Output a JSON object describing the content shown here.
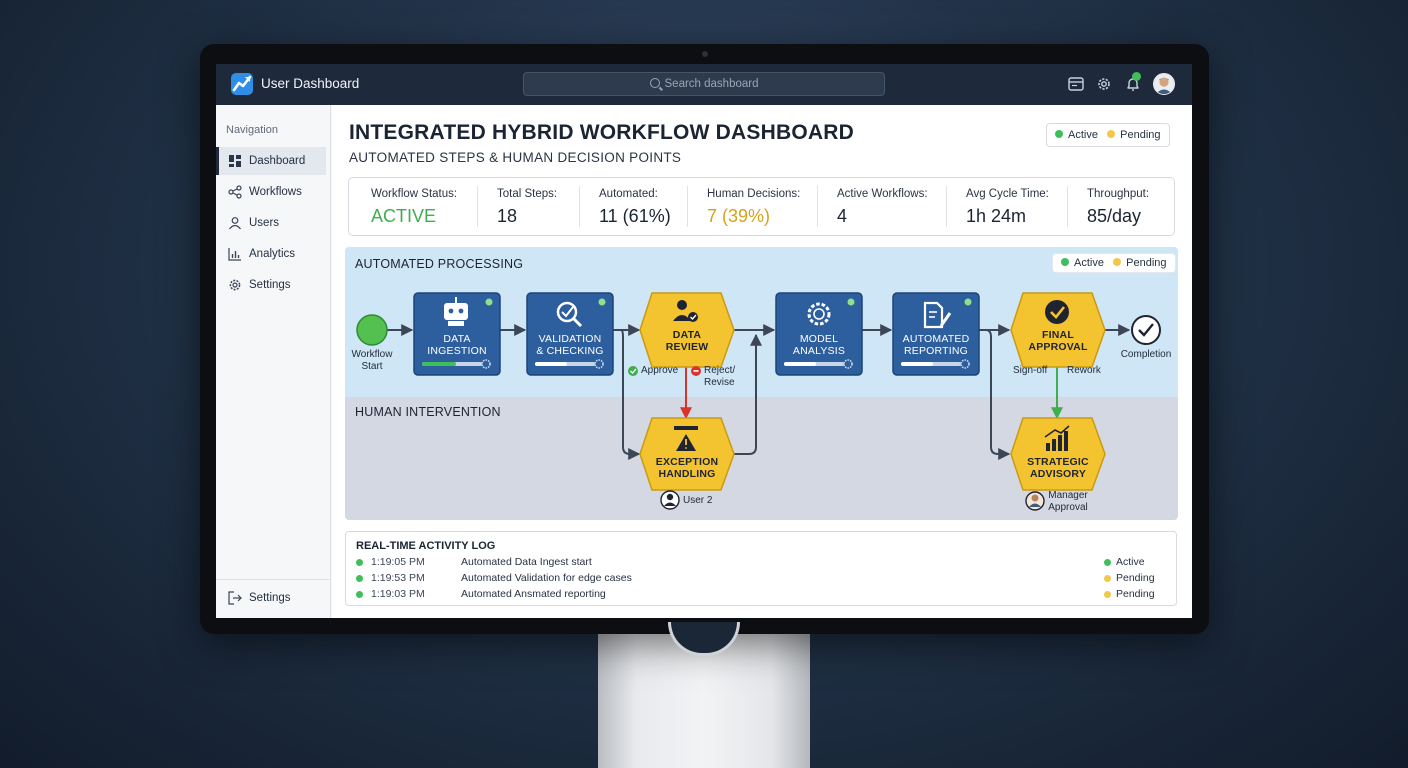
{
  "app": {
    "title": "User Dashboard"
  },
  "search": {
    "placeholder": "Search dashboard"
  },
  "topbar_icons": [
    "browser-window-icon",
    "gear-icon",
    "bell-icon",
    "user-avatar"
  ],
  "sidebar": {
    "heading": "Navigation",
    "items": [
      {
        "label": "Dashboard",
        "icon": "grid-icon",
        "active": true
      },
      {
        "label": "Workflows",
        "icon": "share-nodes-icon",
        "active": false
      },
      {
        "label": "Users",
        "icon": "user-icon",
        "active": false
      },
      {
        "label": "Analytics",
        "icon": "bar-chart-icon",
        "active": false
      },
      {
        "label": "Settings",
        "icon": "gear-icon",
        "active": false
      }
    ],
    "footer_item": {
      "label": "Settings",
      "icon": "logout-icon"
    }
  },
  "header": {
    "title": "INTEGRATED HYBRID WORKFLOW DASHBOARD",
    "subtitle": "AUTOMATED STEPS & HUMAN DECISION POINTS",
    "legend": {
      "active": "Active",
      "pending": "Pending"
    }
  },
  "stats": [
    {
      "label": "Workflow Status:",
      "value": "ACTIVE",
      "color": "#3fae4f"
    },
    {
      "label": "Total Steps:",
      "value": "18",
      "color": "#1b2433"
    },
    {
      "label": "Automated:",
      "value": "11 (61%)",
      "color": "#1b2433"
    },
    {
      "label": "Human Decisions:",
      "value": "7 (39%)",
      "color": "#d6a21e"
    },
    {
      "label": "Active Workflows:",
      "value": "4",
      "color": "#1b2433"
    },
    {
      "label": "Avg Cycle Time:",
      "value": "1h 24m",
      "color": "#1b2433"
    },
    {
      "label": "Throughput:",
      "value": "85/day",
      "color": "#1b2433"
    }
  ],
  "workflow": {
    "lane_automated": "AUTOMATED PROCESSING",
    "lane_human": "HUMAN INTERVENTION",
    "legend": {
      "active": "Active",
      "pending": "Pending"
    },
    "start_label": [
      "Workflow",
      "Start"
    ],
    "end_label": "Completion",
    "nodes": [
      {
        "id": "data-ingestion",
        "lines": [
          "DATA",
          "INGESTION"
        ],
        "kind": "automated",
        "icon": "robot-icon"
      },
      {
        "id": "validation",
        "lines": [
          "VALIDATION",
          "& CHECKING"
        ],
        "kind": "automated",
        "icon": "magnifier-check-icon"
      },
      {
        "id": "data-review",
        "lines": [
          "DATA",
          "REVIEW"
        ],
        "kind": "human",
        "icon": "user-check-icon"
      },
      {
        "id": "model-analysis",
        "lines": [
          "MODEL",
          "ANALYSIS"
        ],
        "kind": "automated",
        "icon": "brain-gear-icon"
      },
      {
        "id": "automated-reporting",
        "lines": [
          "AUTOMATED",
          "REPORTING"
        ],
        "kind": "automated",
        "icon": "document-pen-icon"
      },
      {
        "id": "final-approval",
        "lines": [
          "FINAL",
          "APPROVAL"
        ],
        "kind": "human",
        "icon": "checkmark-circle-icon"
      },
      {
        "id": "exception-handling",
        "lines": [
          "EXCEPTION",
          "HANDLING"
        ],
        "kind": "human",
        "icon": "warning-icon"
      },
      {
        "id": "strategic-advisory",
        "lines": [
          "STRATEGIC",
          "ADVISORY"
        ],
        "kind": "human",
        "icon": "growth-chart-icon"
      }
    ],
    "decisions": {
      "approve": "Approve",
      "reject": [
        "Reject/",
        "Revise"
      ],
      "signoff": "Sign-off",
      "rework": "Rework"
    },
    "assignees": {
      "exception": "User 2",
      "strategic": [
        "Manager",
        "Approval"
      ]
    },
    "colors": {
      "automated": "#2d5f9e",
      "human": "#f4c430",
      "lane_automated": "#cfe6f6",
      "lane_human": "#d3d8e2",
      "start": "#53c04f",
      "reject": "#d9342b",
      "signoff": "#3fae4f"
    }
  },
  "activity_log": {
    "title": "REAL-TIME ACTIVITY LOG",
    "rows": [
      {
        "time": "1:19:05 PM",
        "message": "Automated Data Ingest start",
        "status": "Active"
      },
      {
        "time": "1:19:53 PM",
        "message": "Automated Validation for edge cases",
        "status": "Pending"
      },
      {
        "time": "1:19:03 PM",
        "message": "Automated Ansmated reporting",
        "status": "Pending"
      }
    ]
  }
}
